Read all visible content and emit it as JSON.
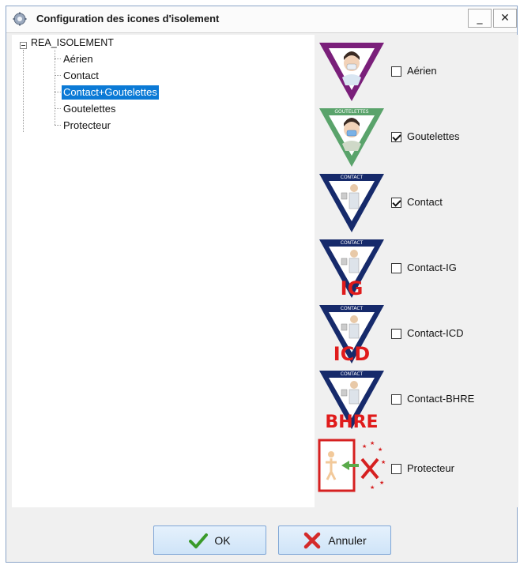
{
  "window": {
    "title": "Configuration des icones d'isolement",
    "minimize_label": "_",
    "close_label": "✕"
  },
  "tree": {
    "root": "REA_ISOLEMENT",
    "items": [
      {
        "label": "Aérien",
        "selected": false
      },
      {
        "label": "Contact",
        "selected": false
      },
      {
        "label": "Contact+Goutelettes",
        "selected": true
      },
      {
        "label": "Goutelettes",
        "selected": false
      },
      {
        "label": "Protecteur",
        "selected": false
      }
    ]
  },
  "icons": [
    {
      "label": "Aérien",
      "checked": false,
      "icon": "aerien-icon",
      "color": "#7a1f7a",
      "banner": ""
    },
    {
      "label": "Goutelettes",
      "checked": true,
      "icon": "goutelettes-icon",
      "color": "#5aa36b",
      "banner": "GOUTELETTES"
    },
    {
      "label": "Contact",
      "checked": true,
      "icon": "contact-icon",
      "color": "#162a6b",
      "banner": "CONTACT"
    },
    {
      "label": "Contact-IG",
      "checked": false,
      "icon": "contact-ig-icon",
      "color": "#162a6b",
      "banner": "CONTACT",
      "overlay": "IG"
    },
    {
      "label": "Contact-ICD",
      "checked": false,
      "icon": "contact-icd-icon",
      "color": "#162a6b",
      "banner": "CONTACT",
      "overlay": "ICD"
    },
    {
      "label": "Contact-BHRE",
      "checked": false,
      "icon": "contact-bhre-icon",
      "color": "#162a6b",
      "banner": "CONTACT",
      "overlay": "BHRE"
    },
    {
      "label": "Protecteur",
      "checked": false,
      "icon": "protecteur-icon",
      "color": "#d62020",
      "banner": ""
    }
  ],
  "buttons": {
    "ok_label": "OK",
    "cancel_label": "Annuler"
  },
  "colors": {
    "selection": "#0b7ad6",
    "overlay_red": "#e01b1b",
    "ok_check": "#3a9a2a",
    "cancel_x": "#d42a2a"
  }
}
